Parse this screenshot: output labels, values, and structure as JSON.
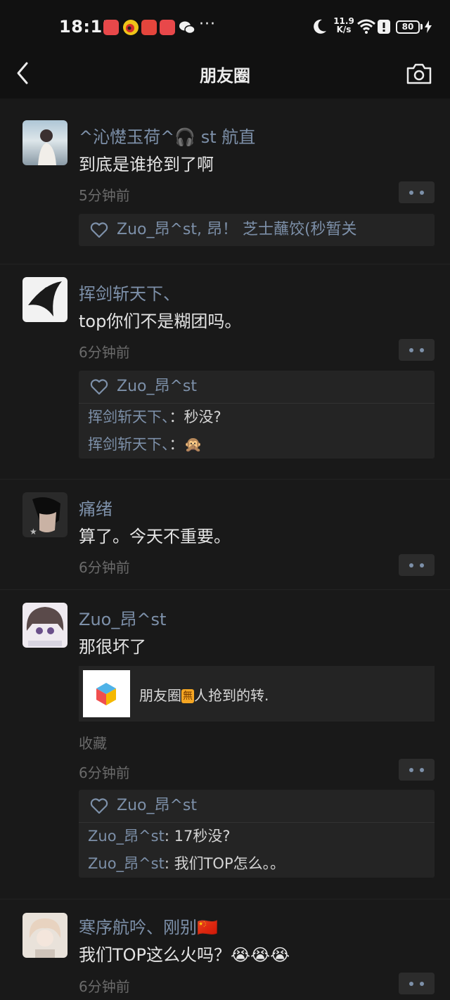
{
  "status_bar": {
    "time": "18:13",
    "apps": [
      "red-app-icon",
      "weibo-icon",
      "huawei-app-icon",
      "red-app-icon",
      "wechat-icon"
    ],
    "more": "···",
    "net_speed_value": "11.9",
    "net_speed_unit": "K/s",
    "battery": "80"
  },
  "nav": {
    "title": "朋友圈"
  },
  "comments": [
    {
      "name": "^沁憷玉荷^🎧  st  航直",
      "text": "到底是谁抢到了啊",
      "time": "5分钟前",
      "likes": "Zuo_昂^st, 昂！ 芝士蘸饺(秒暂关"
    },
    {
      "name": "挥剑斩天下、",
      "text": "top你们不是糊团吗。",
      "time": "6分钟前",
      "likes": "Zuo_昂^st",
      "replies": [
        {
          "name": "挥剑斩天下、",
          "sep": "：",
          "text": "秒没?"
        },
        {
          "name": "挥剑斩天下、",
          "sep": "：",
          "text": "🙊"
        }
      ]
    },
    {
      "name": "痛绪",
      "text": "算了。今天不重要。",
      "time": "6分钟前"
    },
    {
      "name": "Zuo_昂^st",
      "text": "那很坏了",
      "share": {
        "prefix": "朋友圈",
        "badge": "無",
        "suffix": "人抢到的转."
      },
      "favorite": "收藏",
      "time": "6分钟前",
      "likes": "Zuo_昂^st",
      "replies": [
        {
          "name": "Zuo_昂^st",
          "sep": ": ",
          "text": "17秒没?"
        },
        {
          "name": "Zuo_昂^st",
          "sep": ": ",
          "text": "我们TOP怎么。。"
        }
      ]
    },
    {
      "name": "寒序航吟、刚别🇨🇳",
      "text": "我们TOP这么火吗？😭😭😭",
      "time": "6分钟前"
    }
  ],
  "colors": {
    "background": "#191919",
    "bar": "#111111",
    "link": "#7d90a9",
    "card": "#242424"
  }
}
